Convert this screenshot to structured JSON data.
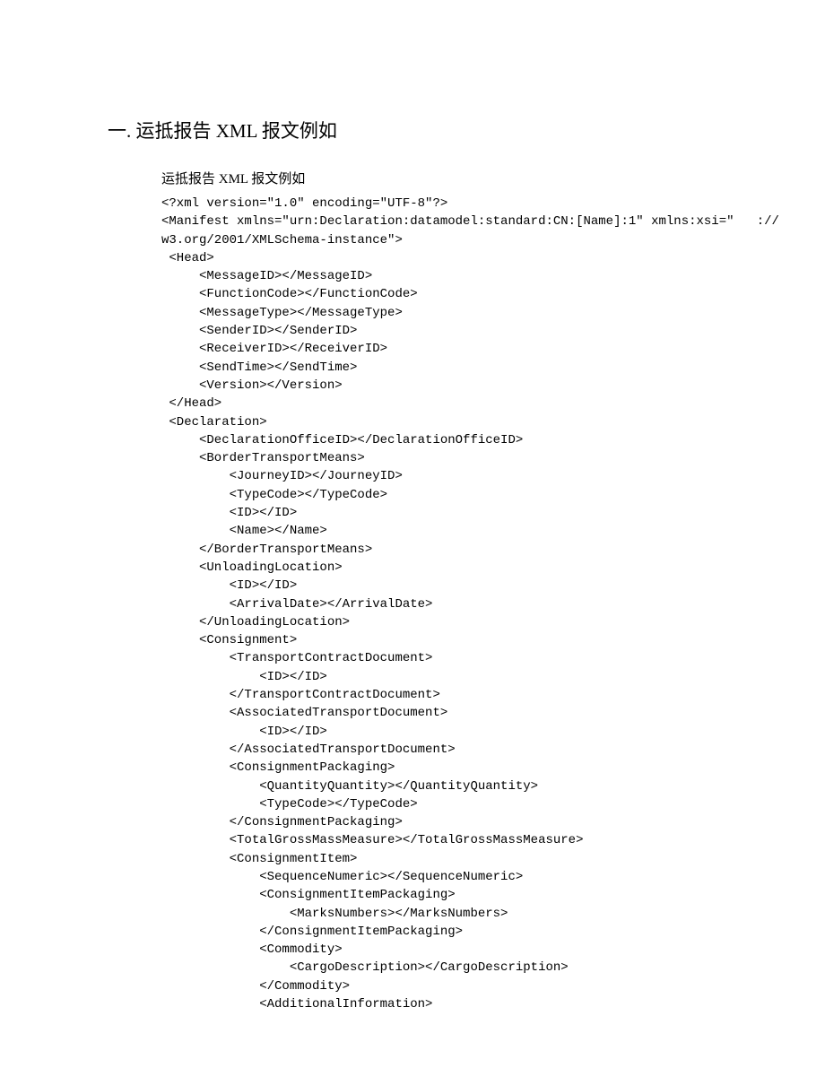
{
  "heading": "一. 运抵报告 XML 报文例如",
  "subheading": "运抵报告 XML 报文例如",
  "code": "<?xml version=\"1.0\" encoding=\"UTF-8\"?>\n<Manifest xmlns=\"urn:Declaration:datamodel:standard:CN:[Name]:1\" xmlns:xsi=\"   ://\nw3.org/2001/XMLSchema-instance\">\n <Head>\n     <MessageID></MessageID>\n     <FunctionCode></FunctionCode>\n     <MessageType></MessageType>\n     <SenderID></SenderID>\n     <ReceiverID></ReceiverID>\n     <SendTime></SendTime>\n     <Version></Version>\n </Head>\n <Declaration>\n     <DeclarationOfficeID></DeclarationOfficeID>\n     <BorderTransportMeans>\n         <JourneyID></JourneyID>\n         <TypeCode></TypeCode>\n         <ID></ID>\n         <Name></Name>\n     </BorderTransportMeans>\n     <UnloadingLocation>\n         <ID></ID>\n         <ArrivalDate></ArrivalDate>\n     </UnloadingLocation>\n     <Consignment>\n         <TransportContractDocument>\n             <ID></ID>\n         </TransportContractDocument>\n         <AssociatedTransportDocument>\n             <ID></ID>\n         </AssociatedTransportDocument>\n         <ConsignmentPackaging>\n             <QuantityQuantity></QuantityQuantity>\n             <TypeCode></TypeCode>\n         </ConsignmentPackaging>\n         <TotalGrossMassMeasure></TotalGrossMassMeasure>\n         <ConsignmentItem>\n             <SequenceNumeric></SequenceNumeric>\n             <ConsignmentItemPackaging>\n                 <MarksNumbers></MarksNumbers>\n             </ConsignmentItemPackaging>\n             <Commodity>\n                 <CargoDescription></CargoDescription>\n             </Commodity>\n             <AdditionalInformation>"
}
